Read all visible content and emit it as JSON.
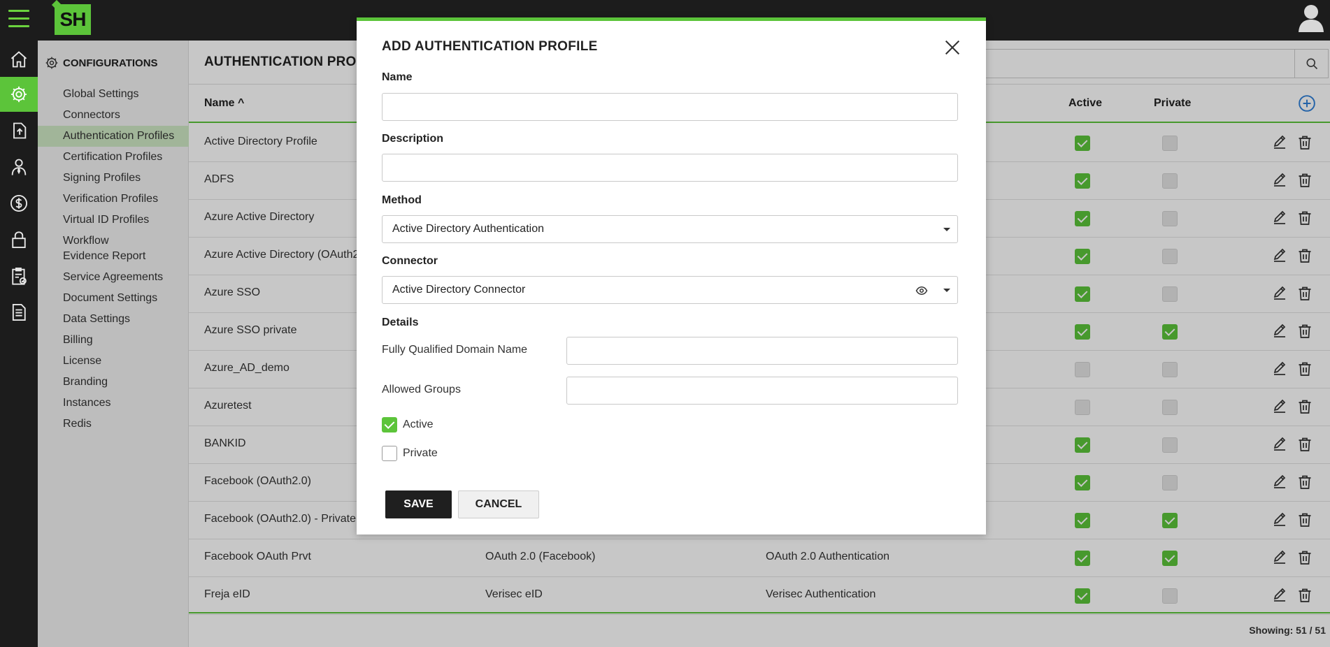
{
  "app": {
    "logo_text": "SH",
    "colors": {
      "accent": "#5cc43a",
      "dark": "#1c1c1c"
    }
  },
  "rail": {
    "icons": [
      "home-icon",
      "gear-icon",
      "upload-icon",
      "user-tie-icon",
      "dollar-icon",
      "lock-icon",
      "clipboard-check-icon",
      "document-icon"
    ],
    "active": "gear-icon"
  },
  "sidebar": {
    "heading": "CONFIGURATIONS",
    "items": [
      {
        "label": "Global Settings"
      },
      {
        "label": "Connectors"
      },
      {
        "label": "Authentication Profiles",
        "active": true
      },
      {
        "label": "Certification Profiles"
      },
      {
        "label": "Signing Profiles"
      },
      {
        "label": "Verification Profiles"
      },
      {
        "label": "Virtual ID Profiles"
      },
      {
        "label": "Workflow Evidence Report"
      },
      {
        "label": "Service Agreements"
      },
      {
        "label": "Document Settings"
      },
      {
        "label": "Data Settings"
      },
      {
        "label": "Billing"
      },
      {
        "label": "License"
      },
      {
        "label": "Branding"
      },
      {
        "label": "Instances"
      },
      {
        "label": "Redis"
      }
    ]
  },
  "main": {
    "title": "AUTHENTICATION PRO",
    "columns": {
      "name": "Name ^",
      "active": "Active",
      "private": "Private"
    },
    "rows": [
      {
        "name": "Active Directory Profile",
        "connector": "",
        "method": "",
        "active": true,
        "private": false
      },
      {
        "name": "ADFS",
        "connector": "",
        "method": "",
        "active": true,
        "private": false
      },
      {
        "name": "Azure Active Directory",
        "connector": "",
        "method": "",
        "active": true,
        "private": false
      },
      {
        "name": "Azure Active Directory (OAuth2",
        "connector": "",
        "method": "",
        "active": true,
        "private": false
      },
      {
        "name": "Azure SSO",
        "connector": "",
        "method": "",
        "active": true,
        "private": false
      },
      {
        "name": "Azure SSO private",
        "connector": "",
        "method": "",
        "active": true,
        "private": true
      },
      {
        "name": "Azure_AD_demo",
        "connector": "",
        "method": "",
        "active": false,
        "private": false
      },
      {
        "name": "Azuretest",
        "connector": "",
        "method": "",
        "active": false,
        "private": false
      },
      {
        "name": "BANKID",
        "connector": "",
        "method": "",
        "active": true,
        "private": false
      },
      {
        "name": "Facebook (OAuth2.0)",
        "connector": "",
        "method": "",
        "active": true,
        "private": false
      },
      {
        "name": "Facebook (OAuth2.0) - Private",
        "connector": "",
        "method": "",
        "active": true,
        "private": true
      },
      {
        "name": "Facebook OAuth Prvt",
        "connector": "OAuth 2.0 (Facebook)",
        "method": "OAuth 2.0 Authentication",
        "active": true,
        "private": true
      },
      {
        "name": "Freja eID",
        "connector": "Verisec eID",
        "method": "Verisec Authentication",
        "active": true,
        "private": false
      }
    ],
    "footer": "Showing: 51 / 51"
  },
  "modal": {
    "title": "ADD AUTHENTICATION PROFILE",
    "name_label": "Name",
    "name_value": "",
    "description_label": "Description",
    "description_value": "",
    "method_label": "Method",
    "method_value": "Active Directory Authentication",
    "connector_label": "Connector",
    "connector_value": "Active Directory Connector",
    "details_label": "Details",
    "fqdn_label": "Fully Qualified Domain Name",
    "fqdn_value": "",
    "groups_label": "Allowed Groups",
    "groups_value": "",
    "active_label": "Active",
    "active_checked": true,
    "private_label": "Private",
    "private_checked": false,
    "save_label": "SAVE",
    "cancel_label": "CANCEL"
  }
}
